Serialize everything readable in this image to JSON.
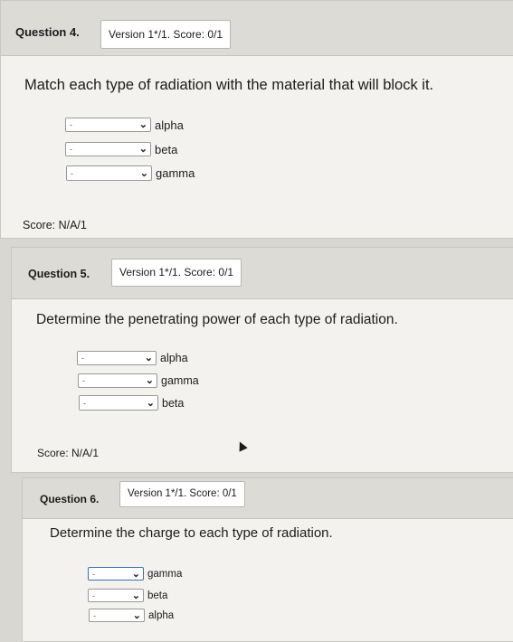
{
  "questions": [
    {
      "label": "Question 4.",
      "version": "Version 1*/1. Score: 0/1",
      "prompt": "Match each type of radiation with the material that will block it.",
      "rows": [
        {
          "value": "-",
          "label": "alpha"
        },
        {
          "value": "-",
          "label": "beta"
        },
        {
          "value": "-",
          "label": "gamma"
        }
      ],
      "score": "Score: N/A/1"
    },
    {
      "label": "Question 5.",
      "version": "Version 1*/1. Score: 0/1",
      "prompt": "Determine the penetrating power of each type of radiation.",
      "rows": [
        {
          "value": "-",
          "label": "alpha"
        },
        {
          "value": "-",
          "label": "gamma"
        },
        {
          "value": "-",
          "label": "beta"
        }
      ],
      "score": "Score: N/A/1"
    },
    {
      "label": "Question 6.",
      "version": "Version 1*/1. Score: 0/1",
      "prompt": "Determine the charge to each type of radiation.",
      "rows": [
        {
          "value": "-",
          "label": "gamma"
        },
        {
          "value": "-",
          "label": "beta"
        },
        {
          "value": "-",
          "label": "alpha"
        }
      ]
    }
  ],
  "icons": {
    "dropdown": "chevron-down-icon",
    "cursor": "mouse-pointer-icon"
  },
  "colors": {
    "card_background": "#f3f2ef",
    "header_background": "#dddbd6",
    "page_background": "#d9d7d2"
  }
}
